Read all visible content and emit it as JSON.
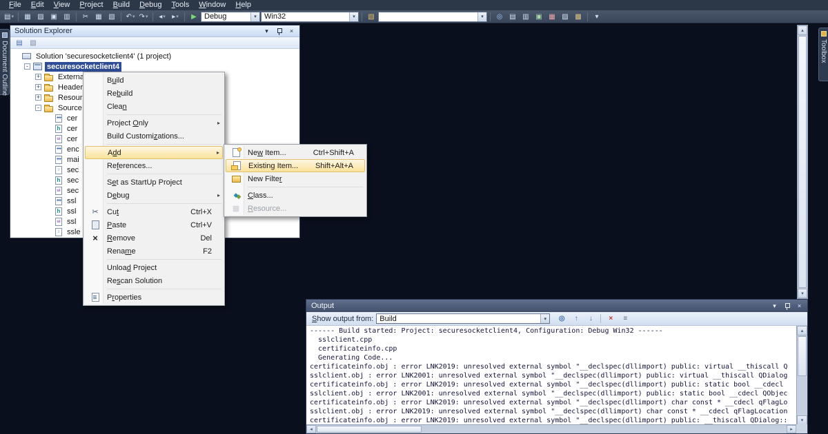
{
  "icons": {
    "dropdown": "▾",
    "close": "×",
    "submenu": "▸",
    "up": "▴",
    "down": "▾",
    "left": "◂",
    "right": "▸"
  },
  "menu_bar": {
    "items": [
      {
        "label": "File",
        "u": 0
      },
      {
        "label": "Edit",
        "u": 0
      },
      {
        "label": "View",
        "u": 0
      },
      {
        "label": "Project",
        "u": 0
      },
      {
        "label": "Build",
        "u": 0
      },
      {
        "label": "Debug",
        "u": 0
      },
      {
        "label": "Tools",
        "u": 0
      },
      {
        "label": "Window",
        "u": 0
      },
      {
        "label": "Help",
        "u": 0
      }
    ]
  },
  "toolbar": {
    "groups_left": [
      [
        {
          "name": "new-item-icon",
          "glyph": "▤",
          "caret": true
        }
      ],
      [
        {
          "name": "add-item-icon",
          "glyph": "▦"
        },
        {
          "name": "open-file-icon",
          "glyph": "▨"
        },
        {
          "name": "save-icon",
          "glyph": "▣"
        },
        {
          "name": "save-all-icon",
          "glyph": "▥"
        }
      ],
      [
        {
          "name": "cut-icon",
          "glyph": "✂"
        },
        {
          "name": "copy-icon",
          "glyph": "▦"
        },
        {
          "name": "paste-icon",
          "glyph": "▧"
        }
      ],
      [
        {
          "name": "undo-icon",
          "glyph": "↶",
          "caret": true
        },
        {
          "name": "redo-icon",
          "glyph": "↷",
          "caret": true
        }
      ],
      [
        {
          "name": "navigate-backward-icon",
          "glyph": "◂",
          "caret": true
        },
        {
          "name": "navigate-forward-icon",
          "glyph": "▸",
          "caret": true
        }
      ]
    ],
    "start_debug": {
      "name": "start-debug-icon",
      "glyph": "▶",
      "color": "#7ed37e"
    },
    "config_value": "Debug",
    "platform_value": "Win32",
    "find_files_icon": {
      "name": "find-in-files-icon",
      "glyph": "▧",
      "color": "#e2c06c"
    },
    "find_value": "",
    "groups_right": [
      [
        {
          "name": "quick-find-icon",
          "glyph": "◎",
          "color": "#9ec7f0"
        },
        {
          "name": "solution-explorer-icon",
          "glyph": "▤",
          "color": "#cfe0f5"
        },
        {
          "name": "properties-window-icon",
          "glyph": "▥",
          "color": "#cfe0f5"
        },
        {
          "name": "object-browser-icon",
          "glyph": "▣",
          "color": "#a8d8a8"
        },
        {
          "name": "error-list-icon",
          "glyph": "▦",
          "color": "#e8a8a8"
        },
        {
          "name": "start-page-icon",
          "glyph": "▨",
          "color": "#cfe0f5"
        },
        {
          "name": "extension-manager-icon",
          "glyph": "▩",
          "color": "#d9c08a"
        }
      ],
      [
        {
          "name": "toolbar-options-icon",
          "glyph": "▾",
          "color": "#cfe0f5"
        }
      ]
    ]
  },
  "left_tab": {
    "label": "Document Outline"
  },
  "right_tab": {
    "label": "Toolbox"
  },
  "solution_explorer": {
    "title": "Solution Explorer",
    "toolbar_icons": [
      {
        "name": "properties-icon",
        "glyph": "▤",
        "color": "#4a6ea8"
      },
      {
        "name": "show-all-files-icon",
        "glyph": "▧",
        "color": "#7a8ba5"
      }
    ],
    "tree": [
      {
        "label": "Solution 'securesocketclient4' (1 project)",
        "depth": 0,
        "icon": "solution"
      },
      {
        "label": "securesocketclient4",
        "depth": 1,
        "icon": "project",
        "exp": "-",
        "selected": true
      },
      {
        "label": "Externa",
        "depth": 2,
        "icon": "folder",
        "exp": "+"
      },
      {
        "label": "Header",
        "depth": 2,
        "icon": "folder",
        "exp": "+"
      },
      {
        "label": "Resour",
        "depth": 2,
        "icon": "folder",
        "exp": "+"
      },
      {
        "label": "Source",
        "depth": 2,
        "icon": "folder",
        "exp": "-"
      },
      {
        "label": "cer",
        "depth": 3,
        "icon": "cpp"
      },
      {
        "label": "cer",
        "depth": 3,
        "icon": "h"
      },
      {
        "label": "cer",
        "depth": 3,
        "icon": "ui"
      },
      {
        "label": "enc",
        "depth": 3,
        "icon": "cpp"
      },
      {
        "label": "mai",
        "depth": 3,
        "icon": "cpp"
      },
      {
        "label": "sec",
        "depth": 3,
        "icon": "doc"
      },
      {
        "label": "sec",
        "depth": 3,
        "icon": "h"
      },
      {
        "label": "sec",
        "depth": 3,
        "icon": "ui"
      },
      {
        "label": "ssl",
        "depth": 3,
        "icon": "cpp"
      },
      {
        "label": "ssl",
        "depth": 3,
        "icon": "h"
      },
      {
        "label": "ssl",
        "depth": 3,
        "icon": "ui"
      },
      {
        "label": "ssle",
        "depth": 3,
        "icon": "doc"
      }
    ]
  },
  "context_menu": {
    "items": [
      {
        "label": "Build",
        "u": 1
      },
      {
        "label": "Rebuild",
        "u": 2
      },
      {
        "label": "Clean",
        "u": 4
      },
      {
        "sep": true
      },
      {
        "label": "Project Only",
        "u": 8,
        "submenu": true
      },
      {
        "label": "Build Customizations...",
        "u": 13
      },
      {
        "sep": true
      },
      {
        "label": "Add",
        "u": 1,
        "submenu": true,
        "highlighted": true
      },
      {
        "label": "References...",
        "u": 2
      },
      {
        "sep": true
      },
      {
        "label": "Set as StartUp Project",
        "u": 1
      },
      {
        "label": "Debug",
        "u": 1,
        "submenu": true
      },
      {
        "sep": true
      },
      {
        "label": "Cut",
        "u": 2,
        "shortcut": "Ctrl+X",
        "icon": "cut"
      },
      {
        "label": "Paste",
        "u": 0,
        "shortcut": "Ctrl+V",
        "icon": "paste"
      },
      {
        "label": "Remove",
        "u": 0,
        "shortcut": "Del",
        "icon": "remove"
      },
      {
        "label": "Rename",
        "u": 4,
        "shortcut": "F2"
      },
      {
        "sep": true
      },
      {
        "label": "Unload Project",
        "u": 5
      },
      {
        "label": "Rescan Solution",
        "u": 2
      },
      {
        "sep": true
      },
      {
        "label": "Properties",
        "u": 1,
        "icon": "properties"
      }
    ]
  },
  "add_submenu": {
    "items": [
      {
        "label": "New Item...",
        "u": 2,
        "shortcut": "Ctrl+Shift+A",
        "icon": "new-item"
      },
      {
        "label": "Existing Item...",
        "u": 7,
        "shortcut": "Shift+Alt+A",
        "icon": "existing-item",
        "highlighted": true
      },
      {
        "label": "New Filter",
        "u": 9,
        "icon": "new-filter"
      },
      {
        "sep": true
      },
      {
        "label": "Class...",
        "u": 0,
        "icon": "class"
      },
      {
        "label": "Resource...",
        "u": 0,
        "icon": "resource",
        "disabled": true
      }
    ]
  },
  "output": {
    "title": "Output",
    "label": "Show output from:",
    "label_u": 0,
    "combo_value": "Build",
    "toolbar_icons": [
      {
        "name": "find-message-icon",
        "glyph": "◎",
        "color": "#3a6ea5"
      },
      {
        "name": "previous-message-icon",
        "glyph": "↑",
        "color": "#3a6ea5"
      },
      {
        "name": "next-message-icon",
        "glyph": "↓",
        "color": "#3a6ea5"
      },
      {
        "sep": true
      },
      {
        "name": "clear-all-icon",
        "glyph": "×",
        "color": "#c0392b"
      },
      {
        "name": "word-wrap-icon",
        "glyph": "≡",
        "color": "#5a6b80"
      }
    ],
    "lines": [
      "------ Build started: Project: securesocketclient4, Configuration: Debug Win32 ------",
      "  sslclient.cpp",
      "  certificateinfo.cpp",
      "  Generating Code...",
      "certificateinfo.obj : error LNK2019: unresolved external symbol \"__declspec(dllimport) public: virtual __thiscall Q",
      "sslclient.obj : error LNK2001: unresolved external symbol \"__declspec(dllimport) public: virtual __thiscall QDialog",
      "certificateinfo.obj : error LNK2019: unresolved external symbol \"__declspec(dllimport) public: static bool __cdecl",
      "sslclient.obj : error LNK2001: unresolved external symbol \"__declspec(dllimport) public: static bool __cdecl QObjec",
      "certificateinfo.obj : error LNK2019: unresolved external symbol \"__declspec(dllimport) char const * __cdecl qFlagLo",
      "sslclient.obj : error LNK2019: unresolved external symbol \"__declspec(dllimport) char const * __cdecl qFlagLocation",
      "certificateinfo.obj : error LNK2019: unresolved external symbol \"__declspec(dllimport) public: __thiscall QDialog::"
    ]
  }
}
